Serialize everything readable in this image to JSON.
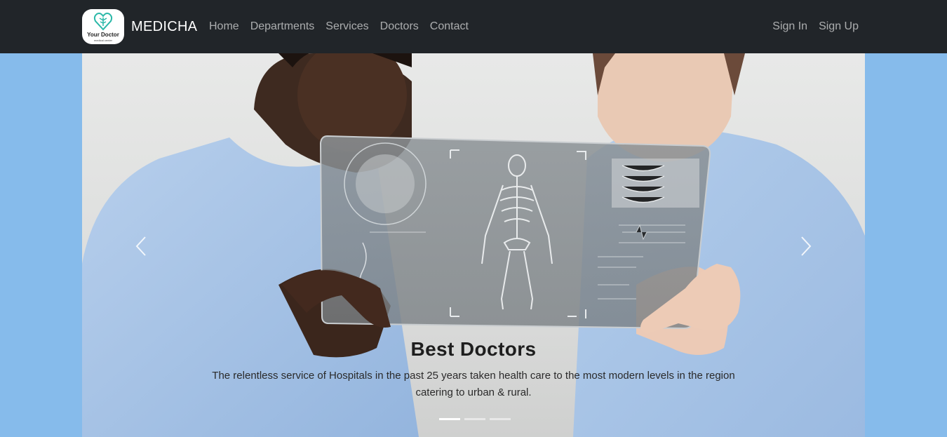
{
  "brand": {
    "logo_text": "Your Doctor",
    "logo_sub": "medical center",
    "name": "MEDICHA"
  },
  "nav": {
    "items": [
      {
        "label": "Home"
      },
      {
        "label": "Departments"
      },
      {
        "label": "Services"
      },
      {
        "label": "Doctors"
      },
      {
        "label": "Contact"
      }
    ],
    "auth": [
      {
        "label": "Sign In"
      },
      {
        "label": "Sign Up"
      }
    ]
  },
  "carousel": {
    "slide_title": "Best Doctors",
    "slide_text": "The relentless service of Hospitals in the past 25 years taken health care to the most modern levels in the region catering to urban & rural.",
    "prev_icon": "chevron-left-icon",
    "next_icon": "chevron-right-icon",
    "active_slide": 1,
    "slide_count": 3
  },
  "colors": {
    "navbar": "#212529",
    "page_background": "#86bbeb",
    "logo_accent": "#2bb8a8",
    "scrubs": "#a9c6e8"
  }
}
